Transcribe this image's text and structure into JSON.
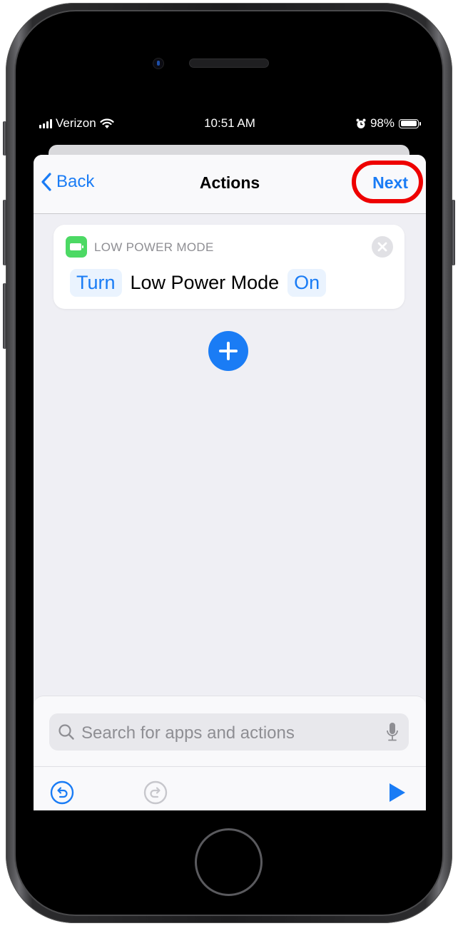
{
  "status_bar": {
    "carrier": "Verizon",
    "time": "10:51 AM",
    "battery_percent": "98%",
    "battery_level": 0.98,
    "icons": [
      "signal-icon",
      "wifi-icon",
      "alarm-icon",
      "battery-icon"
    ]
  },
  "nav": {
    "back_label": "Back",
    "title": "Actions",
    "next_label": "Next"
  },
  "action_card": {
    "app_label": "LOW POWER MODE",
    "app_icon": "battery-icon",
    "app_icon_color": "#4cd964",
    "tokens": [
      {
        "text": "Turn",
        "type": "parameter"
      },
      {
        "text": "Low Power Mode",
        "type": "plain"
      },
      {
        "text": "On",
        "type": "parameter"
      }
    ]
  },
  "add_action": {
    "icon": "plus-icon"
  },
  "search": {
    "placeholder": "Search for apps and actions"
  },
  "toolbar": {
    "undo": "undo-icon",
    "redo": "redo-icon",
    "run": "play-icon"
  },
  "colors": {
    "accent": "#1a7cf5",
    "highlight": "#ee0000",
    "background": "#efeff4"
  }
}
